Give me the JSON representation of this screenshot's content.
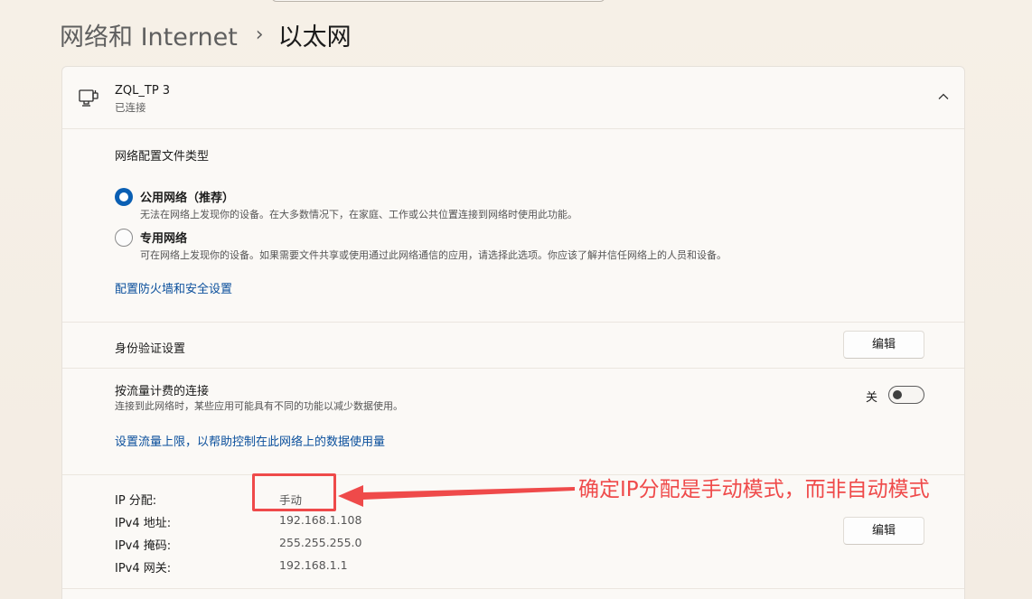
{
  "breadcrumb": {
    "parent": "网络和 Internet",
    "separator": "›",
    "current": "以太网"
  },
  "connection": {
    "name": "ZQL_TP 3",
    "status": "已连接"
  },
  "profile": {
    "heading": "网络配置文件类型",
    "options": [
      {
        "label": "公用网络（推荐）",
        "description": "无法在网络上发现你的设备。在大多数情况下，在家庭、工作或公共位置连接到网络时使用此功能。",
        "selected": true
      },
      {
        "label": "专用网络",
        "description": "可在网络上发现你的设备。如果需要文件共享或使用通过此网络通信的应用，请选择此选项。你应该了解并信任网络上的人员和设备。",
        "selected": false
      }
    ],
    "firewall_link": "配置防火墙和安全设置"
  },
  "auth": {
    "label": "身份验证设置",
    "button": "编辑"
  },
  "metered": {
    "label": "按流量计费的连接",
    "description": "连接到此网络时，某些应用可能具有不同的功能以减少数据使用。",
    "toggle_state": "关",
    "link": "设置流量上限，以帮助控制在此网络上的数据使用量"
  },
  "ip": {
    "rows": [
      {
        "key": "IP 分配:",
        "value": "手动"
      },
      {
        "key": "IPv4 地址:",
        "value": "192.168.1.108"
      },
      {
        "key": "IPv4 掩码:",
        "value": "255.255.255.0"
      },
      {
        "key": "IPv4 网关:",
        "value": "192.168.1.1"
      }
    ],
    "button": "编辑"
  },
  "annotation": {
    "text": "确定IP分配是手动模式，而非自动模式",
    "color": "#ef4a4a"
  },
  "icons": [
    "ethernet-icon",
    "chevron-up-icon",
    "arrow-icon"
  ]
}
